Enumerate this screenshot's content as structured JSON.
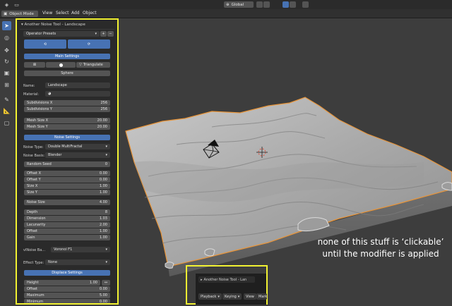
{
  "header": {
    "mode_label": "Object Mode",
    "menus": [
      "View",
      "Select",
      "Add",
      "Object"
    ],
    "transform_orientation": "Global"
  },
  "operator_panel": {
    "title": "Another Noise Tool - Landscape",
    "operator_presets": "Operator Presets",
    "main_settings": "Main Settings",
    "triangulate": "Triangulate",
    "sphere": "Sphere",
    "name_label": "Name:",
    "name_value": "Landscape",
    "material_label": "Material:",
    "subdiv_x_label": "Subdivisions X",
    "subdiv_x_value": "256",
    "subdiv_y_label": "Subdivisions Y",
    "subdiv_y_value": "256",
    "mesh_x_label": "Mesh Size X",
    "mesh_x_value": "20.00",
    "mesh_y_label": "Mesh Size Y",
    "mesh_y_value": "20.00",
    "noise_settings": "Noise Settings",
    "noise_type_label": "Noise Type:",
    "noise_type_value": "Double MultiFractal",
    "noise_basis_label": "Noise Basis:",
    "noise_basis_value": "Blender",
    "random_seed_label": "Random Seed",
    "random_seed_value": "0",
    "offset_x_label": "Offset X",
    "offset_x_value": "0.00",
    "offset_y_label": "Offset Y",
    "offset_y_value": "0.00",
    "size_x_label": "Size X",
    "size_x_value": "1.00",
    "size_y_label": "Size Y",
    "size_y_value": "1.00",
    "noise_size_label": "Noise Size",
    "noise_size_value": "4.00",
    "depth_label": "Depth",
    "depth_value": "8",
    "dimension_label": "Dimension",
    "dimension_value": "1.03",
    "lacunarity_label": "Lacunarity",
    "lacunarity_value": "2.00",
    "offset_label": "Offset",
    "offset_value": "1.00",
    "gain_label": "Gain",
    "gain_value": "1.00",
    "vlnoise_label": "vlNoise Ba...",
    "vlnoise_value": "Voronoi F1",
    "effect_type_label": "Effect Type:",
    "effect_type_value": "None",
    "displace_settings": "Displace Settings",
    "height_label": "Height",
    "height_value": "1.00",
    "disp_offset_label": "Offset",
    "disp_offset_value": "0.00",
    "maximum_label": "Maximum",
    "maximum_value": "5.00",
    "minimum_label": "Minimum",
    "minimum_value": "0.00"
  },
  "bottom_panel": {
    "title": "Another Noise Tool - Lan",
    "playback": "Playback",
    "keying": "Keying",
    "view": "View",
    "marker": "Mark"
  },
  "caption": {
    "line1": "none of this stuff is ‘clickable’",
    "line2": "until the modifier is applied"
  },
  "colors": {
    "highlight": "#f2f232",
    "accent": "#4772b3",
    "terrain_outline": "#e8953a"
  }
}
